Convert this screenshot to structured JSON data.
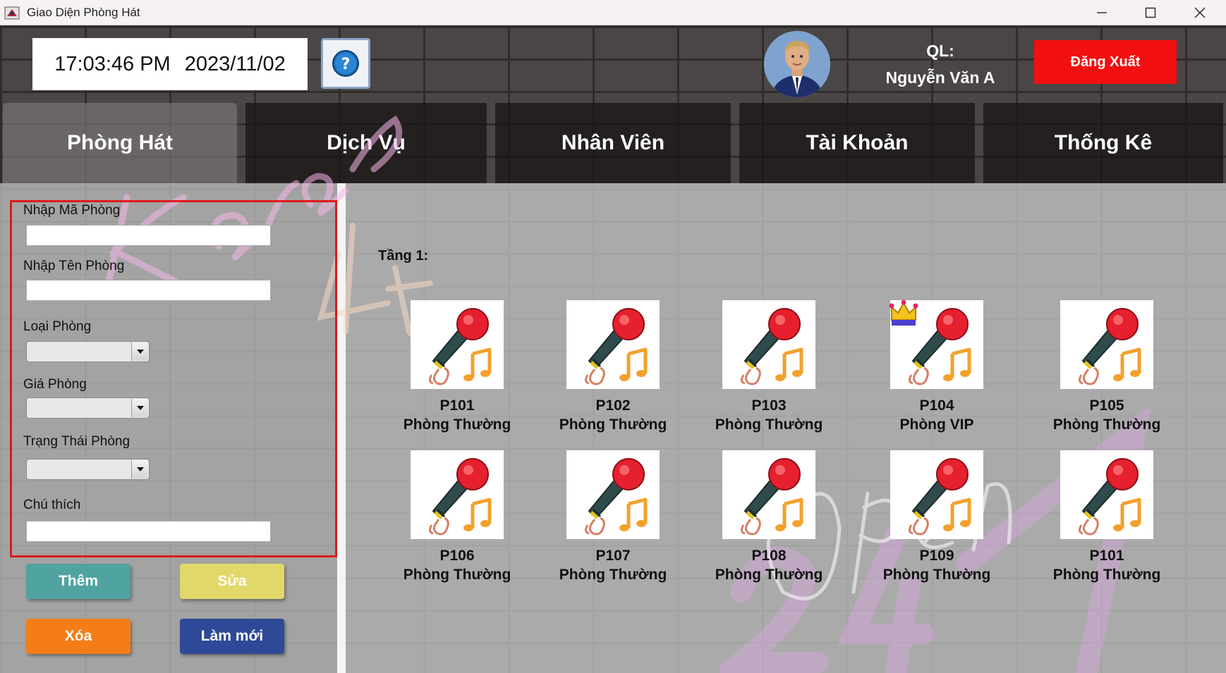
{
  "window": {
    "title": "Giao Diện Phòng Hát"
  },
  "header": {
    "time": "17:03:46 PM",
    "date": "2023/11/02",
    "manager_prefix": "QL:",
    "manager_name": "Nguyễn Văn A",
    "logout_label": "Đăng Xuất"
  },
  "tabs": [
    {
      "label": "Phòng Hát",
      "active": true
    },
    {
      "label": "Dịch Vụ"
    },
    {
      "label": "Nhân Viên"
    },
    {
      "label": "Tài Khoản"
    },
    {
      "label": "Thống Kê"
    }
  ],
  "form": {
    "room_code_label": "Nhập Mã Phòng",
    "room_code_value": "",
    "room_name_label": "Nhập Tên Phòng",
    "room_name_value": "",
    "room_type_label": "Loại Phòng",
    "room_type_value": "",
    "room_price_label": "Giá Phòng",
    "room_price_value": "",
    "room_status_label": "Trạng Thái Phòng",
    "room_status_value": "",
    "note_label": "Chú thích",
    "note_value": ""
  },
  "actions": {
    "add": "Thêm",
    "edit": "Sửa",
    "delete": "Xóa",
    "refresh": "Làm mới"
  },
  "floor": {
    "label": "Tầng 1:"
  },
  "rooms": [
    {
      "code": "P101",
      "type": "Phòng Thường",
      "vip": false
    },
    {
      "code": "P102",
      "type": "Phòng Thường",
      "vip": false
    },
    {
      "code": "P103",
      "type": "Phòng Thường",
      "vip": false
    },
    {
      "code": "P104",
      "type": "Phòng VIP",
      "vip": true
    },
    {
      "code": "P105",
      "type": "Phòng Thường",
      "vip": false
    },
    {
      "code": "P106",
      "type": "Phòng Thường",
      "vip": false
    },
    {
      "code": "P107",
      "type": "Phòng Thường",
      "vip": false
    },
    {
      "code": "P108",
      "type": "Phòng Thường",
      "vip": false
    },
    {
      "code": "P109",
      "type": "Phòng Thường",
      "vip": false
    },
    {
      "code": "P101",
      "type": "Phòng Thường",
      "vip": false
    }
  ],
  "colors": {
    "logout": "#f20f0f",
    "add": "#4fa3a1",
    "edit": "#e2d86a",
    "delete": "#f57d18",
    "refresh": "#2e4a96",
    "form_border": "#e01a1a"
  },
  "icons": {
    "help": "help-icon",
    "room": "microphone-icon",
    "vip": "crown-icon",
    "dropdown": "chevron-down-icon"
  }
}
